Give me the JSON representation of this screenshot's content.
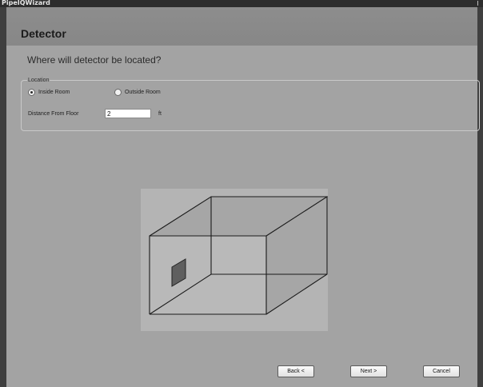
{
  "window": {
    "title": "PipeIQWizard"
  },
  "header": {
    "title": "Detector"
  },
  "question": "Where will detector be located?",
  "location": {
    "legend": "Location",
    "options": [
      {
        "label": "Inside Room",
        "selected": true
      },
      {
        "label": "Outside Room",
        "selected": false
      }
    ]
  },
  "distance": {
    "label": "Distance From Floor",
    "value": "2",
    "unit": "ft"
  },
  "buttons": {
    "back": "Back <",
    "next": "Next >",
    "cancel": "Cancel"
  },
  "colors": {
    "content_bg": "#a3a3a3",
    "header_bg": "#8c8c8c",
    "room_fill": "#b4b4b4",
    "detector_fill": "#5f5f5f"
  }
}
